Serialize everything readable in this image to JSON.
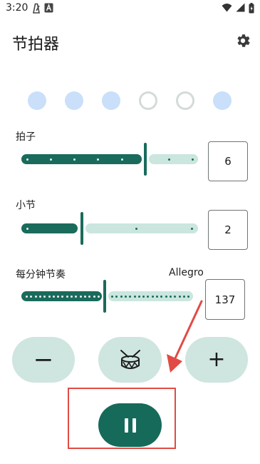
{
  "status_bar": {
    "time": "3:20"
  },
  "header": {
    "title": "节拍器"
  },
  "beats": [
    {
      "state": "accent"
    },
    {
      "state": "accent"
    },
    {
      "state": "accent"
    },
    {
      "state": "muted"
    },
    {
      "state": "muted"
    },
    {
      "state": "accent"
    }
  ],
  "beats_slider": {
    "label": "拍子",
    "value": "6"
  },
  "bars_slider": {
    "label": "小节",
    "value": "2"
  },
  "bpm_slider": {
    "label": "每分钟节奏",
    "tempo_name": "Allegro",
    "value": "137"
  },
  "controls": {
    "minus_symbol": "−",
    "plus_symbol": "+"
  },
  "colors": {
    "accent": "#1a6b5b",
    "track_inactive": "#cae6df",
    "beat_accent": "#c9dffa",
    "annotation": "#e14b45"
  }
}
